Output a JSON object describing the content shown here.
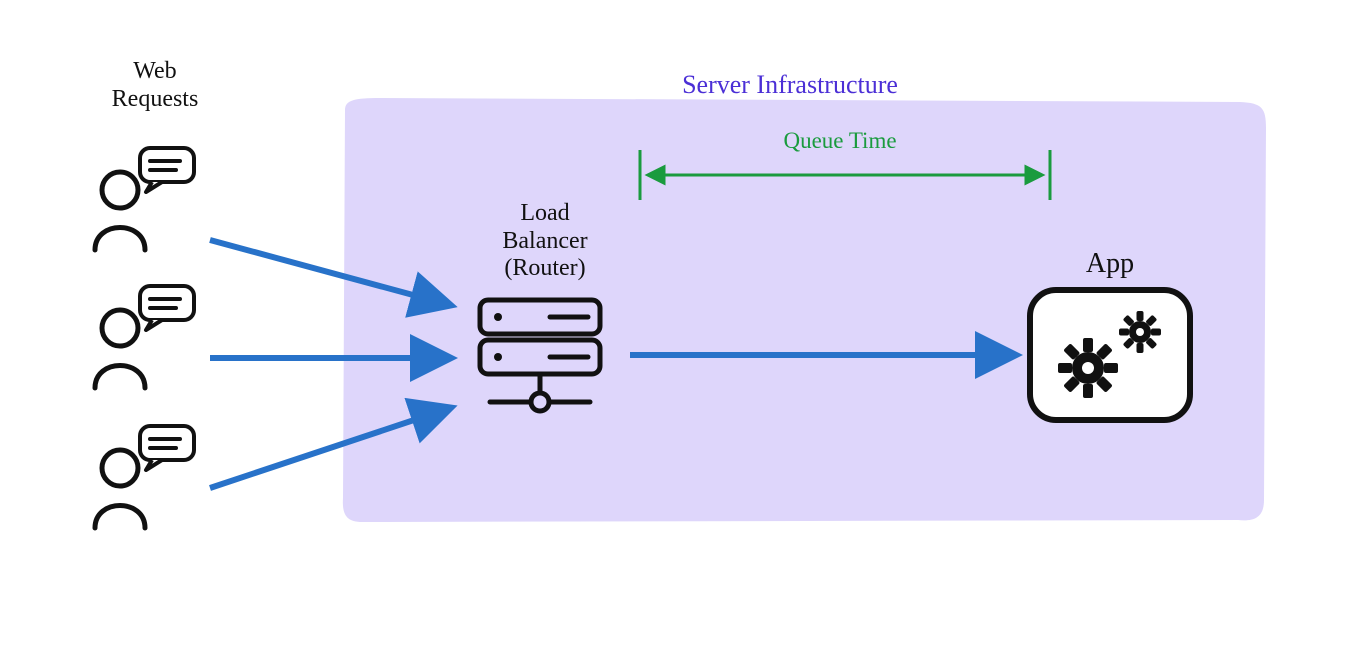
{
  "labels": {
    "web_requests": "Web\nRequests",
    "server_infra": "Server Infrastructure",
    "queue_time": "Queue Time",
    "load_balancer": "Load\nBalancer\n(Router)",
    "app": "App"
  },
  "colors": {
    "arrow": "#2872c9",
    "box_fill": "#ded6fb",
    "box_stroke": "none",
    "queue_green": "#1a9b3e",
    "title_purple": "#4b2fd6",
    "ink": "#111111"
  }
}
